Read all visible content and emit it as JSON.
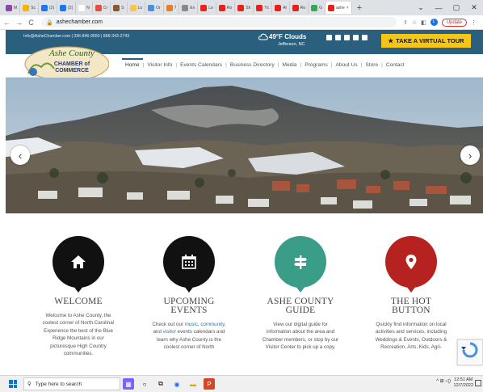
{
  "browser": {
    "tabs": [
      {
        "label": "M",
        "color": "#8e44ad"
      },
      {
        "label": "Sc",
        "color": "#f4b400"
      },
      {
        "label": "(2)",
        "color": "#1877f2"
      },
      {
        "label": "(2)",
        "color": "#1877f2"
      },
      {
        "label": "N",
        "color": "#ffffff"
      },
      {
        "label": "Cr",
        "color": "#e74c3c"
      },
      {
        "label": "S",
        "color": "#8b5a2b"
      },
      {
        "label": "Lo",
        "color": "#f7c843"
      },
      {
        "label": "Or",
        "color": "#4a90e2"
      },
      {
        "label": "7",
        "color": "#e67e22"
      },
      {
        "label": "Ex",
        "color": "#888888"
      },
      {
        "label": "Lo",
        "color": "#e62117"
      },
      {
        "label": "Ro",
        "color": "#e62117"
      },
      {
        "label": "Sh",
        "color": "#e62117"
      },
      {
        "label": "Yc",
        "color": "#e62117"
      },
      {
        "label": "Al",
        "color": "#e62117"
      },
      {
        "label": "Ro",
        "color": "#e62117"
      },
      {
        "label": "G",
        "color": "#34a853"
      }
    ],
    "active_tab": {
      "label": "ashe",
      "close": "×"
    },
    "new_tab": "+",
    "window_controls": [
      "⌄",
      "—",
      "▢",
      "✕"
    ],
    "url": "ashechamber.com",
    "update_label": "Update",
    "profile_initial": "L"
  },
  "site": {
    "contact_line": "Info@AsheChamber.com  |  336-846-9550  |  888-343-2743",
    "weather": {
      "temp": "49°F Clouds",
      "location": "Jefferson, NC"
    },
    "tour_button": "TAKE A VIRTUAL TOUR",
    "logo_text": {
      "line1": "Ashe County",
      "line2": "CHAMBER of",
      "line3": "COMMERCE"
    },
    "menu": [
      "Home",
      "Visitor Info",
      "Events Calendars",
      "Business Directory",
      "Media",
      "Programs",
      "About Us",
      "Store",
      "Contact"
    ]
  },
  "hero": {
    "prev": "‹",
    "next": "›"
  },
  "cards": [
    {
      "name": "welcome",
      "title_lines": [
        "WELCOME"
      ],
      "color": "#111111",
      "icon": "home-icon",
      "text": "Welcome to Ashe County, the coolest corner of North Carolina! Experience the best of the Blue Ridge Mountains in our picturesque High Country communities."
    },
    {
      "name": "upcoming-events",
      "title_lines": [
        "UPCOMING",
        "EVENTS"
      ],
      "color": "#111111",
      "icon": "calendar-icon",
      "text_parts": {
        "a": "Check out our ",
        "link1": "music",
        "b": ", ",
        "link2": "community",
        "c": ", and ",
        "link3": "visitor",
        "d": " events calendars and learn why Ashe County is the coolest corner of North"
      }
    },
    {
      "name": "ashe-county-guide",
      "title_lines": [
        "ASHE COUNTY",
        "GUIDE"
      ],
      "color": "#3a9d88",
      "icon": "signpost-icon",
      "text": "View our digital guide for information about the area and Chamber members, or stop by our Visitor Center to pick up a copy."
    },
    {
      "name": "the-hot-button",
      "title_lines": [
        "THE HOT",
        "BUTTON"
      ],
      "color": "#b5221f",
      "icon": "map-pin-icon",
      "text": "Quickly find information on local activities and services, including Weddings & Events, Outdoors & Recreation, Arts, Kids, Agri-"
    }
  ],
  "taskbar": {
    "search_placeholder": "Type here to search",
    "tray": "^ ⊞ ◁)",
    "time": "12:51 AM",
    "date": "12/7/2022"
  }
}
